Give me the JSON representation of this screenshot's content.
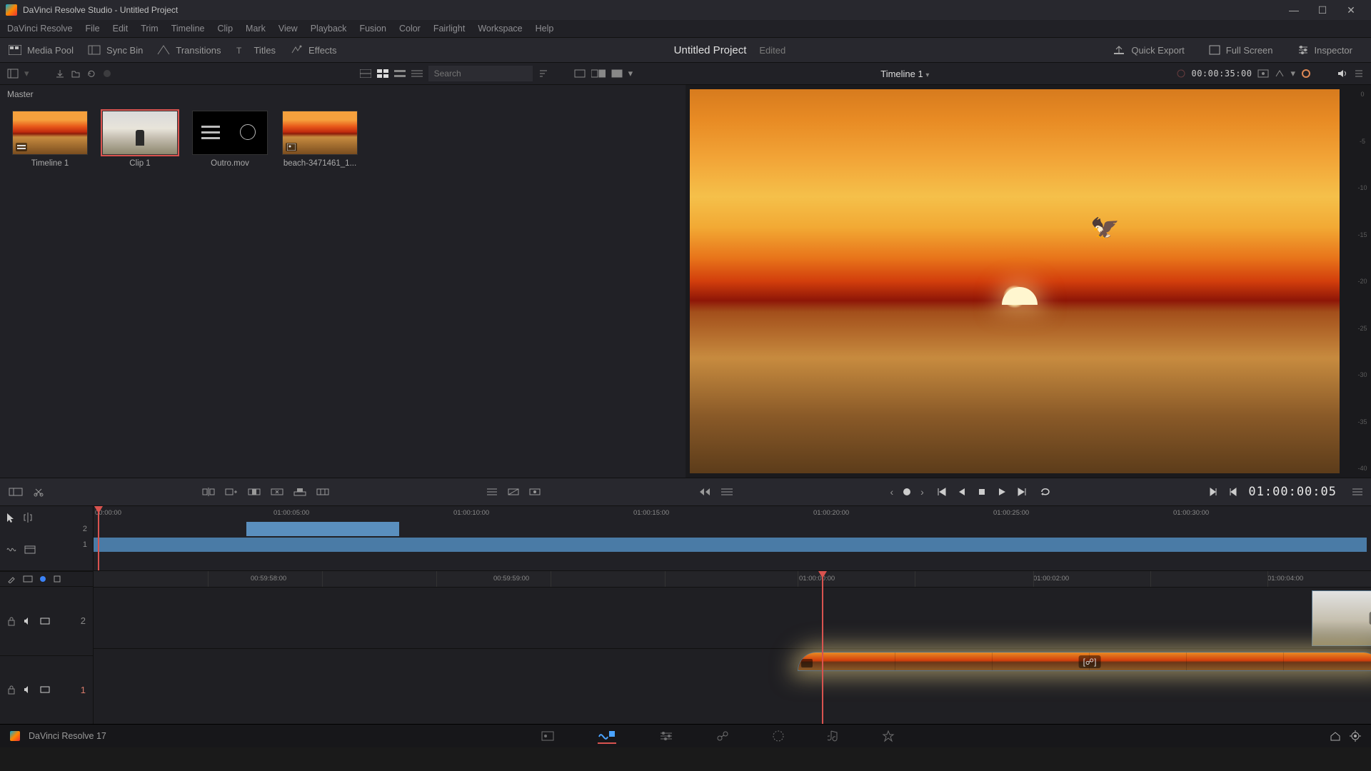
{
  "window": {
    "title": "DaVinci Resolve Studio - Untitled Project"
  },
  "menu": [
    "DaVinci Resolve",
    "File",
    "Edit",
    "Trim",
    "Timeline",
    "Clip",
    "Mark",
    "View",
    "Playback",
    "Fusion",
    "Color",
    "Fairlight",
    "Workspace",
    "Help"
  ],
  "toolbar": {
    "media_pool": "Media Pool",
    "sync_bin": "Sync Bin",
    "transitions": "Transitions",
    "titles": "Titles",
    "effects": "Effects",
    "project_title": "Untitled Project",
    "edited": "Edited",
    "quick_export": "Quick Export",
    "full_screen": "Full Screen",
    "inspector": "Inspector"
  },
  "subbar": {
    "search_placeholder": "Search",
    "timeline_name": "Timeline 1",
    "duration_tc": "00:00:35:00"
  },
  "mediapool": {
    "bin": "Master",
    "clips": [
      {
        "label": "Timeline 1",
        "kind": "sunset"
      },
      {
        "label": "Clip 1",
        "kind": "clip1",
        "selected": true
      },
      {
        "label": "Outro.mov",
        "kind": "black"
      },
      {
        "label": "beach-3471461_1...",
        "kind": "sunset"
      }
    ]
  },
  "viewer": {
    "scale": [
      "0",
      "-5",
      "-10",
      "-15",
      "-20",
      "-25",
      "-30",
      "-35",
      "-40"
    ]
  },
  "transport": {
    "timecode": "01:00:00:05"
  },
  "overview": {
    "ticks": [
      "00:00:00",
      "01:00:05:00",
      "01:00:10:00",
      "01:00:15:00",
      "01:00:20:00",
      "01:00:25:00",
      "01:00:30:00"
    ],
    "track_nums": [
      "2",
      "1"
    ]
  },
  "timeline": {
    "ticks": [
      "00:59:58:00",
      "00:59:59:00",
      "01:00:00:00",
      "01:00:02:00",
      "01:00:04:00"
    ],
    "v2_num": "2",
    "v1_num": "1"
  },
  "status": {
    "app": "DaVinci Resolve 17"
  }
}
